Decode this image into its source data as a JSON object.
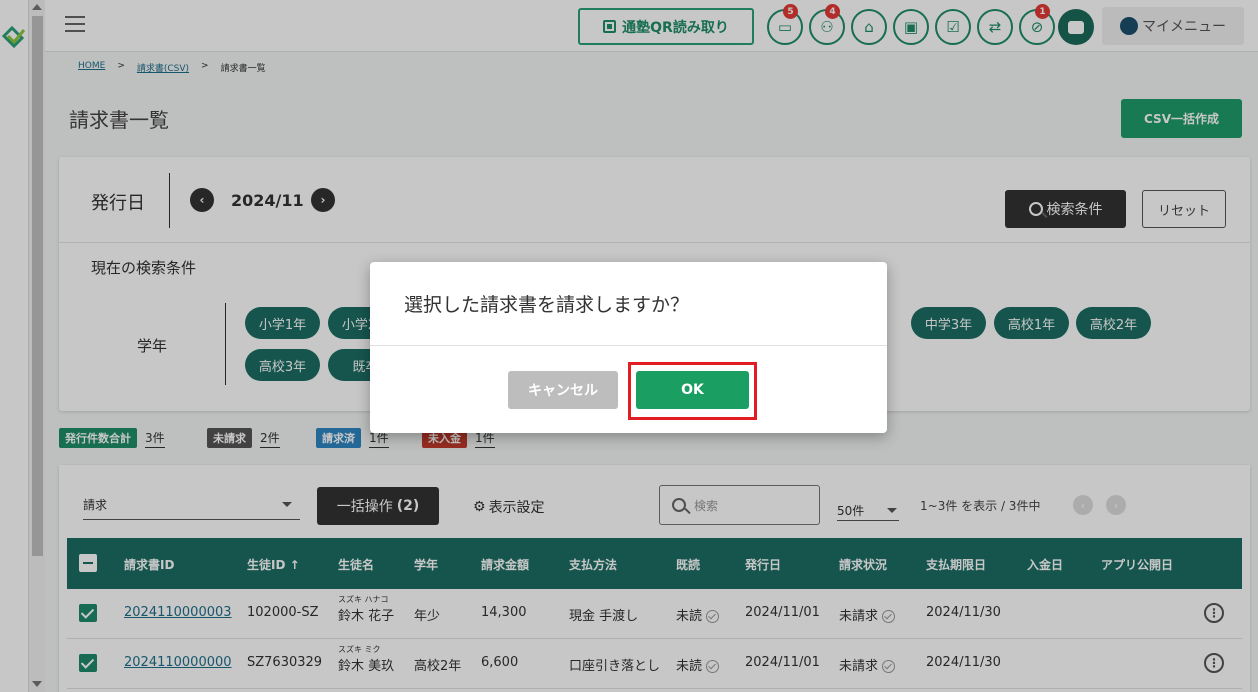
{
  "header": {
    "qr_button": "通塾QR読み取り",
    "badges": {
      "messages": "5",
      "members": "4",
      "alert": "1"
    },
    "my_menu": "マイメニュー"
  },
  "breadcrumb": [
    "HOME",
    "請求書(CSV)",
    "請求書一覧"
  ],
  "page_title": "請求書一覧",
  "csv_button": "CSV一括作成",
  "search": {
    "issue_date_label": "発行日",
    "month": "2024/11",
    "prev": "‹",
    "next": "›",
    "search_button": "検索条件",
    "reset_button": "リセット",
    "current_conditions_label": "現在の検索条件",
    "grade_label": "学年",
    "grade_chips": [
      "小学1年",
      "小学2年",
      "中学3年",
      "高校1年",
      "高校2年",
      "高校3年",
      "既卒"
    ]
  },
  "summary": [
    {
      "label": "発行件数合計",
      "value": "3件",
      "color": "#1f8d68"
    },
    {
      "label": "未請求",
      "value": "2件",
      "color": "#555555"
    },
    {
      "label": "請求済",
      "value": "1件",
      "color": "#2e86c1"
    },
    {
      "label": "未入金",
      "value": "1件",
      "color": "#c0392b"
    }
  ],
  "list": {
    "action_select": "請求",
    "bulk_button": "一括操作",
    "bulk_count": "(2)",
    "display_settings": "表示設定",
    "search_placeholder": "検索",
    "per_page": "50件",
    "range_text": "1~3件 を表示 / 3件中",
    "columns": [
      "請求書ID",
      "生徒ID ↑",
      "生徒名",
      "学年",
      "請求金額",
      "支払方法",
      "既読",
      "発行日",
      "請求状況",
      "支払期限日",
      "入金日",
      "アプリ公開日"
    ],
    "rows": [
      {
        "id": "2024110000003",
        "student_id": "102000-SZ",
        "kana": "スズキ ハナコ",
        "name": "鈴木 花子",
        "grade": "年少",
        "amount": "14,300",
        "payment": "現金 手渡し",
        "read": "未読",
        "issued": "2024/11/01",
        "status": "未請求",
        "due": "2024/11/30"
      },
      {
        "id": "2024110000000",
        "student_id": "SZ7630329",
        "kana": "スズキ ミク",
        "name": "鈴木 美玖",
        "grade": "高校2年",
        "amount": "6,600",
        "payment": "口座引き落とし",
        "read": "未読",
        "issued": "2024/11/01",
        "status": "未請求",
        "due": "2024/11/30"
      }
    ]
  },
  "dialog": {
    "message": "選択した請求書を請求しますか？",
    "cancel": "キャンセル",
    "ok": "OK"
  },
  "colors": {
    "primary": "#1d6e64",
    "accent": "#1b9e62",
    "highlight": "#e31b23"
  }
}
